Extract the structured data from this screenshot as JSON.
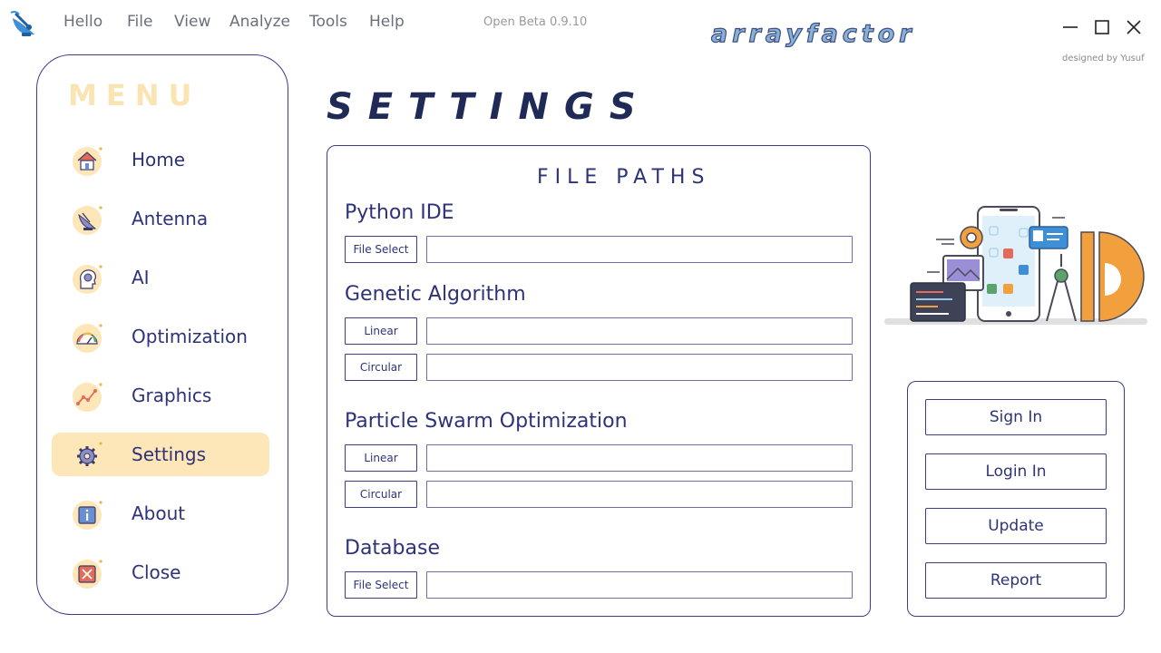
{
  "menubar": {
    "items": [
      "Hello",
      "File",
      "View",
      "Analyze",
      "Tools",
      "Help"
    ],
    "version": "Open Beta 0.9.10",
    "brand": "arrayfactor",
    "credit": "designed by Yusuf"
  },
  "sidebar": {
    "title": "MENU",
    "items": [
      {
        "label": "Home",
        "icon": "home-icon"
      },
      {
        "label": "Antenna",
        "icon": "satellite-dish-icon"
      },
      {
        "label": "AI",
        "icon": "brain-gear-icon"
      },
      {
        "label": "Optimization",
        "icon": "speedometer-icon"
      },
      {
        "label": "Graphics",
        "icon": "line-graph-icon"
      },
      {
        "label": "Settings",
        "icon": "gear-icon",
        "active": true
      },
      {
        "label": "About",
        "icon": "info-icon"
      },
      {
        "label": "Close",
        "icon": "close-box-icon"
      }
    ],
    "accent_color": "#fde6b8"
  },
  "page": {
    "title": "SETTINGS"
  },
  "file_paths": {
    "title": "FILE PATHS",
    "sections": [
      {
        "title": "Python IDE",
        "rows": [
          {
            "button": "File Select",
            "value": ""
          }
        ]
      },
      {
        "title": "Genetic Algorithm",
        "rows": [
          {
            "button": "Linear",
            "value": ""
          },
          {
            "button": "Circular",
            "value": ""
          }
        ]
      },
      {
        "title": "Particle Swarm Optimization",
        "rows": [
          {
            "button": "Linear",
            "value": ""
          },
          {
            "button": "Circular",
            "value": ""
          }
        ]
      },
      {
        "title": "Database",
        "rows": [
          {
            "button": "File Select",
            "value": ""
          }
        ]
      }
    ]
  },
  "account": {
    "buttons": [
      "Sign In",
      "Login In",
      "Update",
      "Report"
    ]
  },
  "colors": {
    "primary": "#2e3379",
    "border": "#3c3d8a",
    "menu_title": "#fbe4b4",
    "highlight": "#fde6b8"
  }
}
